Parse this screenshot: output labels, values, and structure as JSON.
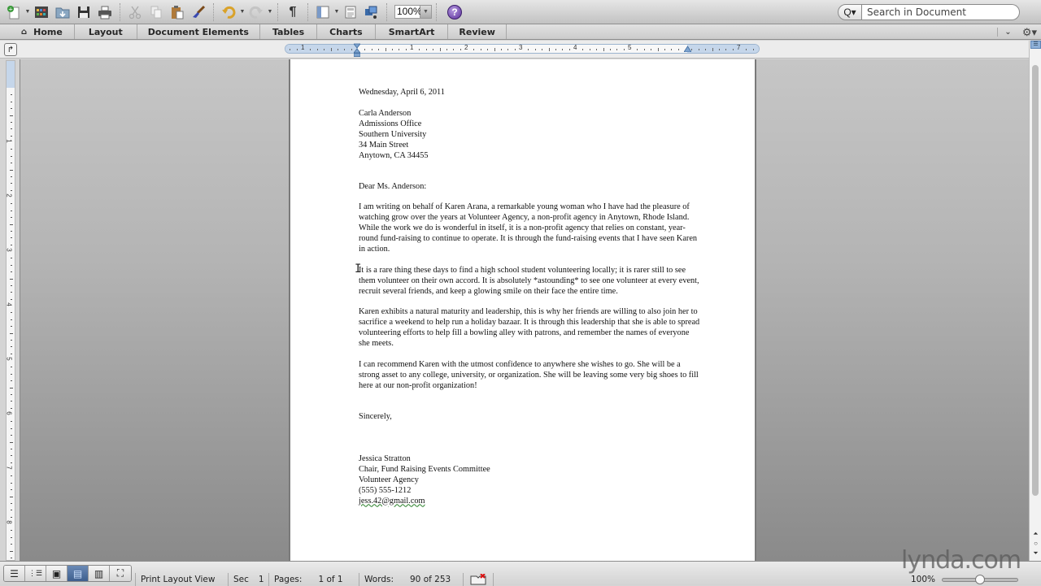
{
  "toolbar": {
    "buttons": [
      {
        "name": "new-document",
        "icon": "new-document-icon"
      },
      {
        "name": "gallery",
        "icon": "template-gallery-icon"
      },
      {
        "name": "open",
        "icon": "open-folder-icon"
      },
      {
        "name": "save",
        "icon": "save-icon"
      },
      {
        "name": "print",
        "icon": "print-icon"
      },
      {
        "name": "cut",
        "icon": "scissors-icon"
      },
      {
        "name": "copy",
        "icon": "copy-icon"
      },
      {
        "name": "paste",
        "icon": "paste-icon"
      },
      {
        "name": "format-painter",
        "icon": "brush-icon"
      },
      {
        "name": "undo",
        "icon": "undo-icon"
      },
      {
        "name": "redo",
        "icon": "redo-icon"
      },
      {
        "name": "show-formatting",
        "icon": "pilcrow-icon"
      },
      {
        "name": "sidebar",
        "icon": "sidebar-icon"
      },
      {
        "name": "view-layout",
        "icon": "layout-icon"
      },
      {
        "name": "media-browser",
        "icon": "media-icon"
      },
      {
        "name": "help",
        "icon": "help-icon"
      }
    ],
    "pilcrow": "¶",
    "zoom_value": "100%",
    "help_glyph": "?",
    "search_placeholder": "Search in Document",
    "search_mode_glyph": "Q▾"
  },
  "ribbon": {
    "tabs": [
      {
        "label": "Home",
        "icon": "home-icon"
      },
      {
        "label": "Layout"
      },
      {
        "label": "Document Elements"
      },
      {
        "label": "Tables"
      },
      {
        "label": "Charts"
      },
      {
        "label": "SmartArt"
      },
      {
        "label": "Review"
      }
    ],
    "collapse_glyph": "⌄",
    "gear_glyph": "⚙▾"
  },
  "ruler": {
    "horizontal_labels": [
      "1",
      "1",
      "2",
      "3",
      "4",
      "5",
      "7"
    ],
    "vertical_labels": [
      "1",
      "2",
      "3",
      "4",
      "5",
      "6",
      "7",
      "8"
    ],
    "tab_selector_glyph": "↱"
  },
  "document": {
    "date": "Wednesday, April 6, 2011",
    "recipient": [
      "Carla Anderson",
      "Admissions Office",
      "Southern University",
      "34 Main Street",
      "Anytown, CA 34455"
    ],
    "salutation": "Dear Ms. Anderson:",
    "paragraphs": [
      "I am writing on behalf of Karen Arana, a remarkable young woman who I have had the pleasure of watching grow over the years at Volunteer Agency, a non-profit agency in Anytown, Rhode Island. While the work we do is wonderful in itself, it is a non-profit agency that relies on constant, year-round fund-raising to continue to operate. It is through the fund-raising events that I have seen Karen in action.",
      "It is a rare thing these days to find a high school student volunteering locally; it is rarer still to see them volunteer on their own accord. It is absolutely *astounding* to see one volunteer at every event, recruit several friends, and keep a glowing smile on their face the entire time.",
      "Karen exhibits a natural maturity and leadership, this is why her friends are willing to also join her to sacrifice a weekend to help run a holiday bazaar. It is through this leadership that she is able to spread volunteering efforts to help fill a bowling alley with patrons, and remember the names of everyone she meets.",
      "I can recommend Karen with the utmost confidence to anywhere she wishes to go. She will be a strong asset to any college, university, or organization. She will be leaving some very big shoes to fill here at our non-profit organization!"
    ],
    "closing": "Sincerely,",
    "signature": [
      "Jessica Stratton",
      "Chair, Fund Raising Events Committee",
      "Volunteer Agency",
      "(555) 555-1212"
    ],
    "email": "jess.42@gmail.com"
  },
  "statusbar": {
    "view_buttons": [
      {
        "name": "draft-view",
        "glyph": "☰",
        "active": false
      },
      {
        "name": "outline-view",
        "glyph": "⋮☰",
        "active": false
      },
      {
        "name": "publishing-layout-view",
        "glyph": "▣",
        "active": false
      },
      {
        "name": "print-layout-view",
        "glyph": "▤",
        "active": true
      },
      {
        "name": "notebook-layout-view",
        "glyph": "▥",
        "active": false
      },
      {
        "name": "full-screen-view",
        "glyph": "⛶",
        "active": false
      }
    ],
    "view_name": "Print Layout View",
    "section_label": "Sec",
    "section_value": "1",
    "pages_label": "Pages:",
    "pages_value": "1 of 1",
    "words_label": "Words:",
    "words_value": "90 of 253",
    "zoom_label": "100%",
    "zoom_fraction": 0.5
  },
  "watermark": "lynda.com"
}
